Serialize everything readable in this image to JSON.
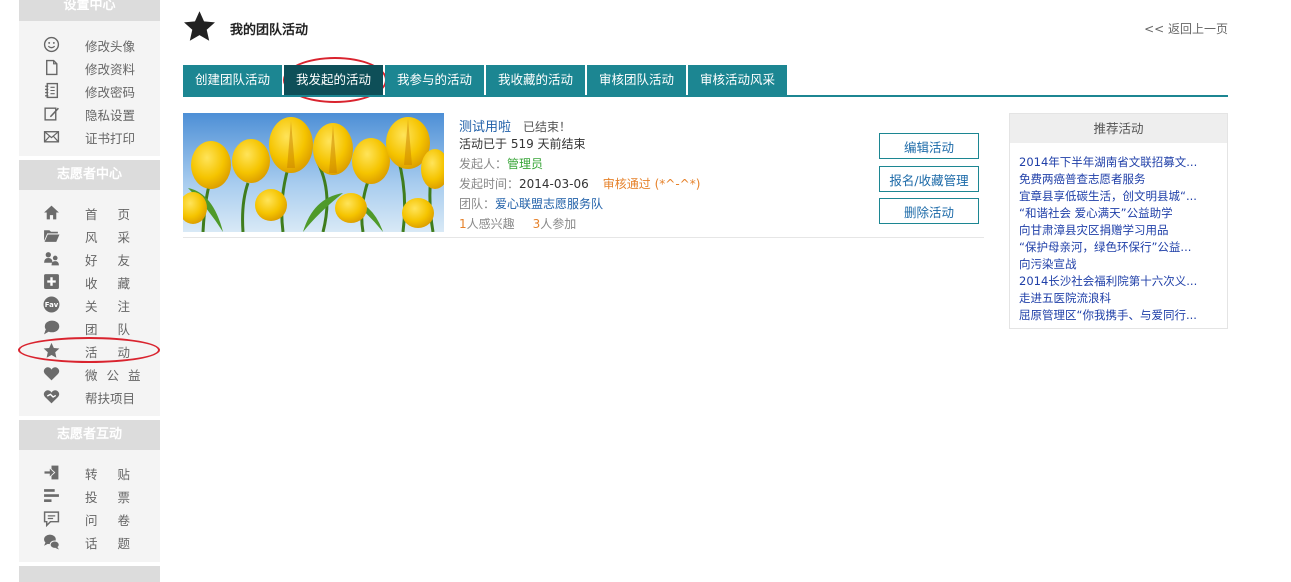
{
  "sidebar": {
    "sections": {
      "settings": "设置中心",
      "volunteer": "志愿者中心",
      "interact": "志愿者互动"
    },
    "settings_items": [
      {
        "label": "修改头像",
        "icon": "smile-icon"
      },
      {
        "label": "修改资料",
        "icon": "document-icon"
      },
      {
        "label": "修改密码",
        "icon": "list-icon"
      },
      {
        "label": "隐私设置",
        "icon": "edit-icon"
      },
      {
        "label": "证书打印",
        "icon": "mail-icon"
      }
    ],
    "volunteer_items": [
      {
        "label": "首页",
        "icon": "home-icon"
      },
      {
        "label": "风采",
        "icon": "folder-icon"
      },
      {
        "label": "好友",
        "icon": "users-icon"
      },
      {
        "label": "收藏",
        "icon": "plus-box-icon"
      },
      {
        "label": "关注",
        "icon": "fav-icon"
      },
      {
        "label": "团队",
        "icon": "chat-icon"
      },
      {
        "label": "活动",
        "icon": "star-icon"
      },
      {
        "label": "微公益",
        "icon": "heart-icon"
      },
      {
        "label": "帮扶项目",
        "icon": "handshake-icon"
      }
    ],
    "interact_items": [
      {
        "label": "转贴",
        "icon": "share-icon"
      },
      {
        "label": "投票",
        "icon": "bars-icon"
      },
      {
        "label": "问卷",
        "icon": "comment-icon"
      },
      {
        "label": "话题",
        "icon": "topic-icon"
      }
    ]
  },
  "header": {
    "title": "我的团队活动",
    "back": "<< 返回上一页"
  },
  "tabs": [
    {
      "label": "创建团队活动"
    },
    {
      "label": "我发起的活动"
    },
    {
      "label": "我参与的活动"
    },
    {
      "label": "我收藏的活动"
    },
    {
      "label": "审核团队活动"
    },
    {
      "label": "审核活动风采"
    }
  ],
  "activity": {
    "name": "测试用啦",
    "status": "已结束！",
    "ended_text": "活动已于 519 天前结束",
    "initiator_label": "发起人：",
    "initiator": "管理员",
    "time_label": "发起时间：",
    "time": "2014-03-06",
    "review": "审核通过 (*^-^*)",
    "team_label": "团队：",
    "team": "爱心联盟志愿服务队",
    "interested_count": "1",
    "interested_label": "人感兴趣",
    "joined_count": "3",
    "joined_label": "人参加",
    "buttons": {
      "edit": "编辑活动",
      "signup": "报名/收藏管理",
      "delete": "删除活动"
    }
  },
  "recommend": {
    "title": "推荐活动",
    "items": [
      "2014年下半年湖南省文联招募文...",
      "免费两癌普查志愿者服务",
      "宜章县享低碳生活，创文明县城“...",
      "“和谐社会 爱心满天”公益助学",
      "向甘肃漳县灾区捐赠学习用品",
      "“保护母亲河，绿色环保行”公益...",
      "向污染宣战",
      "2014长沙社会福利院第十六次义...",
      "走进五医院流浪科",
      "屈原管理区“你我携手、与爱同行..."
    ]
  },
  "colors": {
    "tab": "#1c8692",
    "tab_active": "#0e4f58",
    "link": "#1f5fa8",
    "highlight": "#d9232e"
  }
}
